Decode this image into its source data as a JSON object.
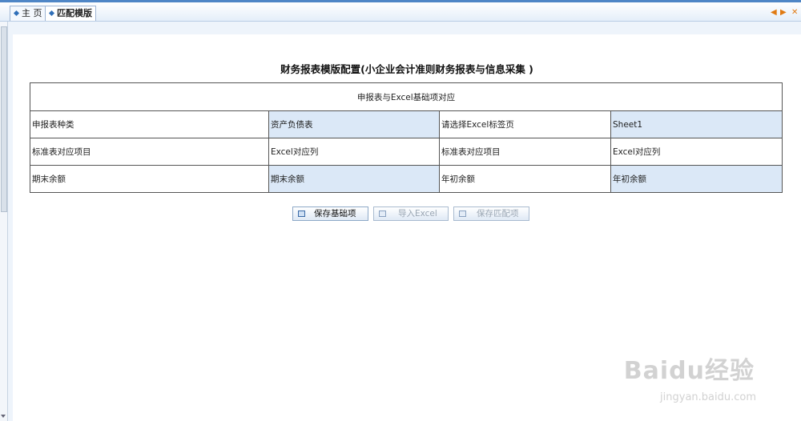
{
  "tabs": [
    {
      "label": "主 页"
    },
    {
      "label": "匹配模版"
    }
  ],
  "tab_controls": {
    "prev": "◆",
    "next": "◆",
    "close": "✕"
  },
  "page": {
    "title": "财务报表模版配置(小企业会计准则财务报表与信息采集 )"
  },
  "table": {
    "header": "申报表与Excel基础项对应",
    "rows": [
      [
        "申报表种类",
        "资产负债表",
        "请选择Excel标签页",
        "Sheet1"
      ],
      [
        "标准表对应项目",
        "Excel对应列",
        "标准表对应项目",
        "Excel对应列"
      ],
      [
        "期末余额",
        "期末余额",
        "年初余额",
        "年初余额"
      ]
    ]
  },
  "buttons": {
    "save_base": "保存基础项",
    "import_excel": "导入Excel",
    "save_match": "保存匹配项"
  },
  "watermark": {
    "brand": "Baidu经验",
    "url": "jingyan.baidu.com"
  },
  "colors": {
    "accent": "#4f86c6",
    "cell_highlight": "#dbe8f7",
    "control_orange": "#e07a12"
  }
}
